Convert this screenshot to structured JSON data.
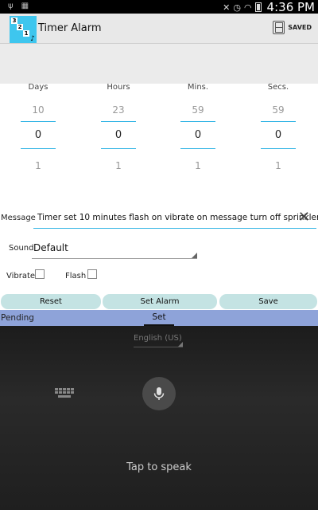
{
  "status_bar": {
    "time": "4:36 PM"
  },
  "app": {
    "title": "Timer Alarm",
    "icon_digits": [
      "3",
      "2",
      "1"
    ]
  },
  "toolbar": {
    "saved_label": "SAVED"
  },
  "pickers": [
    {
      "label": "Days",
      "prev": "10",
      "value": "0",
      "next": "1"
    },
    {
      "label": "Hours",
      "prev": "23",
      "value": "0",
      "next": "1"
    },
    {
      "label": "Mins.",
      "prev": "59",
      "value": "0",
      "next": "1"
    },
    {
      "label": "Secs.",
      "prev": "59",
      "value": "0",
      "next": "1"
    }
  ],
  "message": {
    "label": "Message",
    "value": "Timer set 10 minutes flash on vibrate on message turn off sprinklers"
  },
  "sound": {
    "label": "Sound",
    "value": "Default"
  },
  "options": {
    "vibrate_label": "Vibrate",
    "flash_label": "Flash",
    "vibrate_checked": false,
    "flash_checked": false
  },
  "buttons": {
    "reset": "Reset",
    "set_alarm": "Set Alarm",
    "save": "Save"
  },
  "tabs": {
    "pending": "Pending",
    "set": "Set"
  },
  "voice": {
    "language": "English (US)",
    "prompt": "Tap to speak"
  },
  "colors": {
    "accent": "#33b5e5",
    "button_bg": "#c4e3e3",
    "tab_bar": "#8ea3d9",
    "app_icon": "#3ec6ee"
  }
}
